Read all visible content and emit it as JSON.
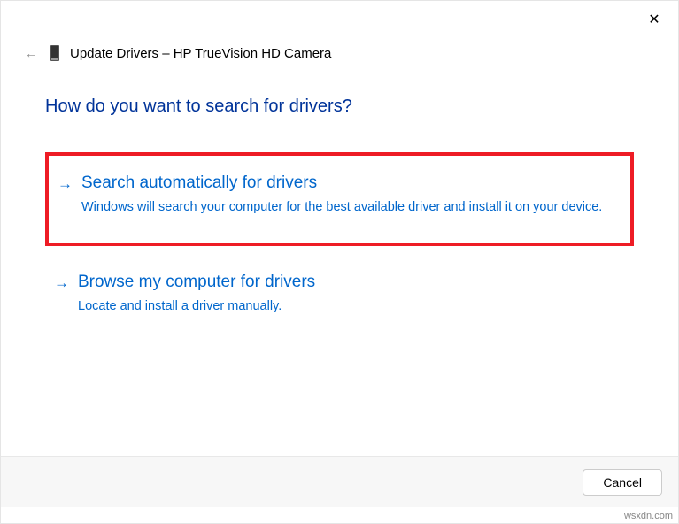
{
  "header": {
    "title": "Update Drivers – HP TrueVision HD Camera"
  },
  "content": {
    "question": "How do you want to search for drivers?",
    "options": [
      {
        "title": "Search automatically for drivers",
        "description": "Windows will search your computer for the best available driver and install it on your device.",
        "highlighted": true
      },
      {
        "title": "Browse my computer for drivers",
        "description": "Locate and install a driver manually.",
        "highlighted": false
      }
    ]
  },
  "footer": {
    "cancel_label": "Cancel"
  },
  "watermark": "wsxdn.com"
}
